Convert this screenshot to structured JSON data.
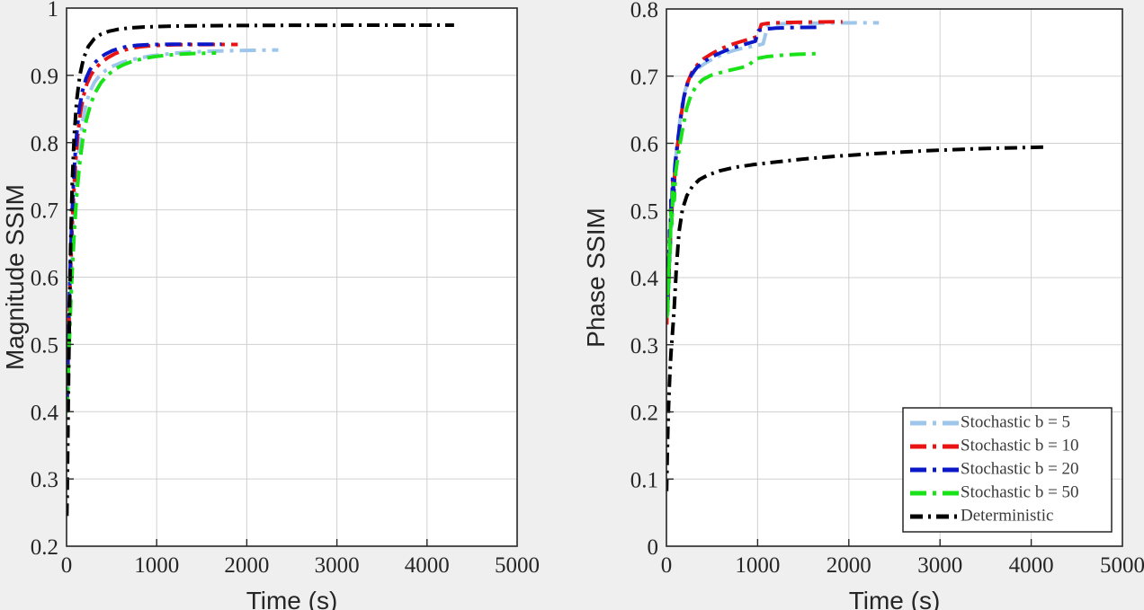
{
  "figure": {
    "background_color": "#efefef",
    "plot_background_color": "#ffffff",
    "axis_color": "#262626",
    "grid_color": "#d0d0d0"
  },
  "series_style": {
    "stochastic_b5": {
      "label": "Stochastic b = 5",
      "color": "#9dc6ea",
      "dash": "18,7,4,7",
      "width": 4
    },
    "stochastic_b10": {
      "label": "Stochastic b = 10",
      "color": "#e81414",
      "dash": "18,7,4,7",
      "width": 4
    },
    "stochastic_b20": {
      "label": "Stochastic b = 20",
      "color": "#0a18c8",
      "dash": "18,7,4,7",
      "width": 4
    },
    "stochastic_b50": {
      "label": "Stochastic b = 50",
      "color": "#19e219",
      "dash": "18,7,4,7",
      "width": 4
    },
    "deterministic": {
      "label": "Deterministic",
      "color": "#000000",
      "dash": "14,6,3,6",
      "width": 4
    }
  },
  "legend": {
    "position": "bottom-right-of-right-panel",
    "entries": [
      {
        "label": "Stochastic b = 5",
        "color": "#9dc6ea"
      },
      {
        "label": "Stochastic b = 10",
        "color": "#e81414"
      },
      {
        "label": "Stochastic b = 20",
        "color": "#0a18c8"
      },
      {
        "label": "Stochastic b = 50",
        "color": "#19e219"
      },
      {
        "label": "Deterministic",
        "color": "#000000"
      }
    ]
  },
  "chart_data": [
    {
      "id": "magnitude-ssim-chart",
      "type": "line",
      "title": "",
      "xlabel": "Time (s)",
      "ylabel": "Magnitude SSIM",
      "xlim": [
        0,
        5000
      ],
      "ylim": [
        0.2,
        1.0
      ],
      "xticks": [
        0,
        1000,
        2000,
        3000,
        4000,
        5000
      ],
      "xticklabels": [
        "0",
        "1000",
        "2000",
        "3000",
        "4000",
        "5000"
      ],
      "yticks": [
        0.2,
        0.3,
        0.4,
        0.5,
        0.6,
        0.7,
        0.8,
        0.9,
        1.0
      ],
      "yticklabels": [
        "0.2",
        "0.3",
        "0.4",
        "0.5",
        "0.6",
        "0.7",
        "0.8",
        "0.9",
        "1"
      ],
      "grid": true,
      "legend_visible": false,
      "series": [
        {
          "name": "Stochastic b = 5",
          "color": "#9dc6ea",
          "x": [
            5,
            18,
            32,
            48,
            65,
            85,
            110,
            140,
            175,
            215,
            260,
            310,
            370,
            440,
            520,
            610,
            710,
            820,
            940,
            1070,
            1210,
            1360,
            1520,
            1690,
            1870,
            2060,
            2200,
            2350
          ],
          "y": [
            0.4,
            0.455,
            0.515,
            0.575,
            0.635,
            0.695,
            0.748,
            0.793,
            0.829,
            0.857,
            0.876,
            0.89,
            0.9,
            0.908,
            0.914,
            0.919,
            0.923,
            0.926,
            0.929,
            0.931,
            0.933,
            0.9345,
            0.9355,
            0.9363,
            0.9368,
            0.9372,
            0.9375,
            0.9377
          ]
        },
        {
          "name": "Stochastic b = 10",
          "color": "#e81414",
          "x": [
            5,
            16,
            28,
            42,
            58,
            76,
            97,
            122,
            152,
            187,
            227,
            272,
            325,
            385,
            455,
            535,
            625,
            725,
            835,
            955,
            1085,
            1225,
            1375,
            1535,
            1700,
            1800,
            1900
          ],
          "y": [
            0.405,
            0.47,
            0.535,
            0.6,
            0.66,
            0.715,
            0.765,
            0.808,
            0.843,
            0.869,
            0.888,
            0.901,
            0.911,
            0.919,
            0.926,
            0.932,
            0.937,
            0.9405,
            0.9428,
            0.9442,
            0.945,
            0.9455,
            0.9457,
            0.9458,
            0.9459,
            0.9459,
            0.9459
          ]
        },
        {
          "name": "Stochastic b = 20",
          "color": "#0a18c8",
          "x": [
            5,
            15,
            27,
            40,
            55,
            72,
            92,
            116,
            144,
            177,
            215,
            258,
            308,
            365,
            430,
            505,
            590,
            685,
            790,
            905,
            1030,
            1165,
            1310,
            1465,
            1620,
            1720
          ],
          "y": [
            0.41,
            0.478,
            0.545,
            0.612,
            0.672,
            0.727,
            0.776,
            0.818,
            0.852,
            0.877,
            0.895,
            0.908,
            0.918,
            0.9255,
            0.9315,
            0.9365,
            0.9405,
            0.9432,
            0.9448,
            0.9456,
            0.946,
            0.9462,
            0.9463,
            0.9463,
            0.9463,
            0.9462
          ]
        },
        {
          "name": "Stochastic b = 50",
          "color": "#19e219",
          "x": [
            5,
            17,
            31,
            47,
            66,
            88,
            113,
            143,
            178,
            219,
            266,
            320,
            382,
            453,
            534,
            626,
            730,
            846,
            975,
            1115,
            1265,
            1425,
            1590,
            1660
          ],
          "y": [
            0.398,
            0.45,
            0.505,
            0.562,
            0.618,
            0.672,
            0.722,
            0.766,
            0.803,
            0.833,
            0.857,
            0.875,
            0.889,
            0.9,
            0.909,
            0.9155,
            0.9208,
            0.9248,
            0.9278,
            0.93,
            0.9315,
            0.9325,
            0.933,
            0.9332
          ]
        },
        {
          "name": "Deterministic",
          "color": "#000000",
          "x": [
            3,
            8,
            14,
            22,
            32,
            45,
            62,
            84,
            112,
            147,
            190,
            242,
            305,
            380,
            470,
            575,
            700,
            850,
            1030,
            1240,
            1490,
            1780,
            2110,
            2480,
            2890,
            3330,
            3800,
            4300
          ],
          "y": [
            0.245,
            0.285,
            0.355,
            0.445,
            0.545,
            0.645,
            0.735,
            0.808,
            0.862,
            0.9,
            0.926,
            0.943,
            0.954,
            0.961,
            0.9655,
            0.9685,
            0.9705,
            0.9718,
            0.9727,
            0.9733,
            0.9737,
            0.974,
            0.9742,
            0.9744,
            0.9745,
            0.9746,
            0.9747,
            0.9747
          ]
        }
      ]
    },
    {
      "id": "phase-ssim-chart",
      "type": "line",
      "title": "",
      "xlabel": "Time (s)",
      "ylabel": "Phase SSIM",
      "xlim": [
        0,
        5000
      ],
      "ylim": [
        0,
        0.8
      ],
      "xticks": [
        0,
        1000,
        2000,
        3000,
        4000,
        5000
      ],
      "xticklabels": [
        "0",
        "1000",
        "2000",
        "3000",
        "4000",
        "5000"
      ],
      "yticks": [
        0,
        0.1,
        0.2,
        0.3,
        0.4,
        0.5,
        0.6,
        0.7,
        0.8
      ],
      "yticklabels": [
        "0",
        "0.1",
        "0.2",
        "0.3",
        "0.4",
        "0.5",
        "0.6",
        "0.7",
        "0.8"
      ],
      "grid": true,
      "legend_visible": true,
      "series": [
        {
          "name": "Stochastic b = 5",
          "color": "#9dc6ea",
          "x": [
            4,
            10,
            16,
            22,
            28,
            34,
            40,
            48,
            56,
            64,
            74,
            86,
            100,
            118,
            140,
            168,
            205,
            250,
            305,
            370,
            445,
            530,
            625,
            730,
            845,
            970,
            1020,
            1060,
            1110,
            1160,
            1400,
            1700,
            2000,
            2330
          ],
          "y": [
            0.335,
            0.375,
            0.345,
            0.41,
            0.385,
            0.455,
            0.425,
            0.5,
            0.47,
            0.535,
            0.505,
            0.555,
            0.575,
            0.598,
            0.625,
            0.655,
            0.679,
            0.695,
            0.706,
            0.714,
            0.721,
            0.727,
            0.733,
            0.738,
            0.742,
            0.745,
            0.7465,
            0.748,
            0.775,
            0.7775,
            0.7785,
            0.779,
            0.7793,
            0.7795
          ]
        },
        {
          "name": "Stochastic b = 10",
          "color": "#e81414",
          "x": [
            4,
            10,
            16,
            22,
            28,
            34,
            41,
            49,
            58,
            68,
            80,
            94,
            111,
            132,
            158,
            190,
            230,
            280,
            340,
            410,
            492,
            585,
            690,
            805,
            930,
            1000,
            1040,
            1100,
            1200,
            1350,
            1550,
            1750,
            1930
          ],
          "y": [
            0.33,
            0.385,
            0.355,
            0.425,
            0.395,
            0.465,
            0.44,
            0.51,
            0.485,
            0.545,
            0.52,
            0.565,
            0.585,
            0.608,
            0.638,
            0.668,
            0.69,
            0.706,
            0.717,
            0.726,
            0.733,
            0.74,
            0.746,
            0.751,
            0.756,
            0.759,
            0.777,
            0.7785,
            0.7795,
            0.78,
            0.7805,
            0.7808,
            0.781
          ]
        },
        {
          "name": "Stochastic b = 20",
          "color": "#0a18c8",
          "x": [
            4,
            10,
            16,
            22,
            28,
            34,
            41,
            49,
            58,
            68,
            80,
            94,
            111,
            132,
            158,
            190,
            230,
            278,
            336,
            405,
            487,
            580,
            685,
            800,
            925,
            975,
            1010,
            1080,
            1200,
            1350,
            1500,
            1650
          ],
          "y": [
            0.345,
            0.39,
            0.36,
            0.43,
            0.4,
            0.47,
            0.445,
            0.515,
            0.49,
            0.55,
            0.525,
            0.568,
            0.588,
            0.612,
            0.64,
            0.668,
            0.688,
            0.703,
            0.713,
            0.721,
            0.728,
            0.734,
            0.74,
            0.745,
            0.75,
            0.752,
            0.768,
            0.77,
            0.7715,
            0.7722,
            0.7726,
            0.7728
          ]
        },
        {
          "name": "Stochastic b = 50",
          "color": "#19e219",
          "x": [
            4,
            10,
            16,
            22,
            28,
            34,
            41,
            50,
            60,
            72,
            86,
            103,
            124,
            150,
            182,
            222,
            270,
            330,
            400,
            485,
            585,
            700,
            830,
            900,
            980,
            1100,
            1250,
            1420,
            1600,
            1680
          ],
          "y": [
            0.34,
            0.38,
            0.35,
            0.42,
            0.39,
            0.46,
            0.435,
            0.505,
            0.48,
            0.54,
            0.515,
            0.558,
            0.578,
            0.6,
            0.625,
            0.652,
            0.672,
            0.686,
            0.695,
            0.701,
            0.705,
            0.709,
            0.713,
            0.716,
            0.726,
            0.729,
            0.731,
            0.7325,
            0.7333,
            0.7335
          ]
        },
        {
          "name": "Deterministic",
          "color": "#000000",
          "x": [
            2,
            5,
            9,
            14,
            20,
            28,
            38,
            50,
            65,
            84,
            108,
            138,
            176,
            224,
            285,
            362,
            460,
            584,
            742,
            940,
            1190,
            1500,
            1880,
            2330,
            2850,
            3430,
            4180
          ],
          "y": [
            0.082,
            0.105,
            0.135,
            0.165,
            0.195,
            0.225,
            0.258,
            0.288,
            0.315,
            0.352,
            0.412,
            0.468,
            0.502,
            0.522,
            0.536,
            0.546,
            0.553,
            0.559,
            0.564,
            0.568,
            0.572,
            0.5765,
            0.581,
            0.585,
            0.589,
            0.592,
            0.5945
          ]
        }
      ]
    }
  ]
}
